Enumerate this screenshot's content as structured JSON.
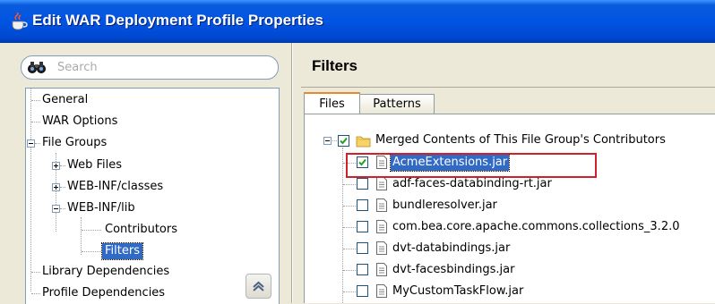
{
  "window": {
    "title": "Edit WAR Deployment Profile Properties",
    "icon": "java-cup-icon"
  },
  "search": {
    "placeholder": "Search",
    "value": ""
  },
  "nav_tree": {
    "items": [
      {
        "label": "General",
        "depth": 0,
        "expander": "none",
        "selected": false
      },
      {
        "label": "WAR Options",
        "depth": 0,
        "expander": "none",
        "selected": false
      },
      {
        "label": "File Groups",
        "depth": 0,
        "expander": "minus",
        "selected": false
      },
      {
        "label": "Web Files",
        "depth": 1,
        "expander": "plus",
        "selected": false
      },
      {
        "label": "WEB-INF/classes",
        "depth": 1,
        "expander": "plus",
        "selected": false
      },
      {
        "label": "WEB-INF/lib",
        "depth": 1,
        "expander": "minus",
        "selected": false
      },
      {
        "label": "Contributors",
        "depth": 2,
        "expander": "none",
        "selected": false
      },
      {
        "label": "Filters",
        "depth": 2,
        "expander": "none",
        "selected": true
      },
      {
        "label": "Library Dependencies",
        "depth": 0,
        "expander": "none",
        "selected": false
      },
      {
        "label": "Profile Dependencies",
        "depth": 0,
        "expander": "none",
        "selected": false
      }
    ]
  },
  "main": {
    "title": "Filters",
    "tabs": [
      {
        "label": "Files",
        "active": true
      },
      {
        "label": "Patterns",
        "active": false
      }
    ],
    "file_tree": {
      "root": {
        "label": "Merged Contents of This File Group's Contributors",
        "checked": true,
        "expander": "minus"
      },
      "files": [
        {
          "label": "AcmeExtensions.jar",
          "checked": true,
          "selected": true,
          "highlighted": true
        },
        {
          "label": "adf-faces-databinding-rt.jar",
          "checked": false
        },
        {
          "label": "bundleresolver.jar",
          "checked": false
        },
        {
          "label": "com.bea.core.apache.commons.collections_3.2.0",
          "checked": false
        },
        {
          "label": "dvt-databindings.jar",
          "checked": false
        },
        {
          "label": "dvt-facesbindings.jar",
          "checked": false
        },
        {
          "label": "MyCustomTaskFlow.jar",
          "checked": false
        }
      ]
    }
  },
  "colors": {
    "titlebar": "#0054e3",
    "selection": "#316ac5",
    "highlight_border": "#d0202a",
    "dialog_bg": "#ece9d8",
    "checkmark": "#21a121"
  }
}
